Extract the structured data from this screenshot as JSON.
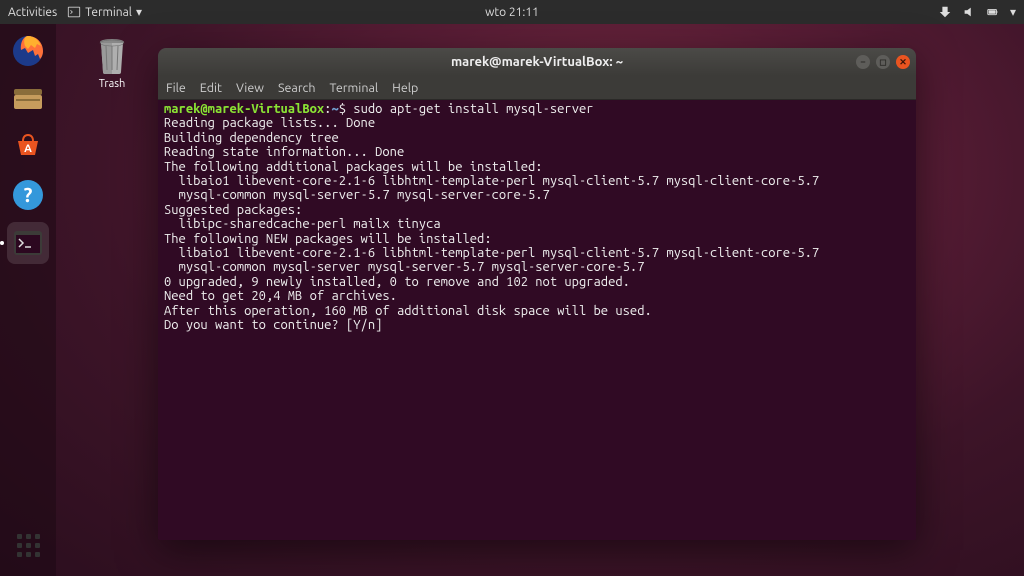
{
  "topbar": {
    "activities": "Activities",
    "app_menu_label": "Terminal",
    "clock": "wto 21:11"
  },
  "desktop": {
    "trash_label": "Trash"
  },
  "launcher": {
    "items": [
      {
        "name": "firefox"
      },
      {
        "name": "files"
      },
      {
        "name": "software"
      },
      {
        "name": "help"
      },
      {
        "name": "terminal"
      }
    ]
  },
  "terminal": {
    "title": "marek@marek-VirtualBox: ~",
    "menus": [
      "File",
      "Edit",
      "View",
      "Search",
      "Terminal",
      "Help"
    ],
    "prompt_user": "marek@marek-VirtualBox",
    "prompt_path": "~",
    "prompt_symbol": "$",
    "command": "sudo apt-get install mysql-server",
    "output_lines": [
      "Reading package lists... Done",
      "Building dependency tree",
      "Reading state information... Done",
      "The following additional packages will be installed:",
      "  libaio1 libevent-core-2.1-6 libhtml-template-perl mysql-client-5.7 mysql-client-core-5.7",
      "  mysql-common mysql-server-5.7 mysql-server-core-5.7",
      "Suggested packages:",
      "  libipc-sharedcache-perl mailx tinyca",
      "The following NEW packages will be installed:",
      "  libaio1 libevent-core-2.1-6 libhtml-template-perl mysql-client-5.7 mysql-client-core-5.7",
      "  mysql-common mysql-server mysql-server-5.7 mysql-server-core-5.7",
      "0 upgraded, 9 newly installed, 0 to remove and 102 not upgraded.",
      "Need to get 20,4 MB of archives.",
      "After this operation, 160 MB of additional disk space will be used.",
      "Do you want to continue? [Y/n]"
    ]
  }
}
